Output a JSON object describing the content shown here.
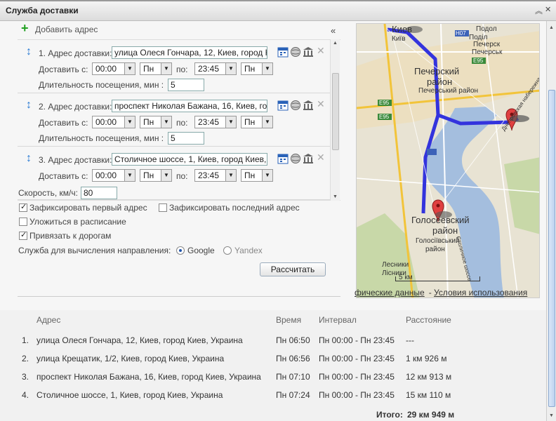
{
  "window": {
    "title": "Служба доставки",
    "restore_icon": "«",
    "minimize_icon": "»"
  },
  "panel": {
    "add_label": "Добавить адрес",
    "collapse_icon": "«"
  },
  "items": [
    {
      "num": "1.",
      "label": "Адрес доставки:",
      "address": "улица Олеся Гончара, 12, Киев, город К",
      "deliver_label": "Доставить с:",
      "from_time": "00:00",
      "from_day": "Пн",
      "to_label": "по:",
      "to_time": "23:45",
      "to_day": "Пн",
      "duration_label": "Длительность посещения, мин :",
      "duration": "5"
    },
    {
      "num": "2.",
      "label": "Адрес доставки:",
      "address": "проспект Николая Бажана, 16, Киев, го",
      "deliver_label": "Доставить с:",
      "from_time": "00:00",
      "from_day": "Пн",
      "to_label": "по:",
      "to_time": "23:45",
      "to_day": "Пн",
      "duration_label": "Длительность посещения, мин :",
      "duration": "5"
    },
    {
      "num": "3.",
      "label": "Адрес доставки:",
      "address": "Столичное шоссе, 1, Киев, город Киев,",
      "deliver_label": "Доставить с:",
      "from_time": "00:00",
      "from_day": "Пн",
      "to_label": "по:",
      "to_time": "23:45",
      "to_day": "Пн"
    }
  ],
  "options": {
    "speed_label": "Скорость, км/ч:",
    "speed": "80",
    "fix_first": {
      "label": "Зафиксировать первый адрес",
      "checked": true
    },
    "fix_last": {
      "label": "Зафиксировать последний адрес",
      "checked": false
    },
    "schedule": {
      "label": "Уложиться в расписание",
      "checked": false
    },
    "snap": {
      "label": "Привязать к дорогам",
      "checked": true
    },
    "service_label": "Служба для вычисления направления:",
    "google": "Google",
    "yandex": "Yandex",
    "calc_button": "Рассчитать"
  },
  "map": {
    "labels": [
      "Київ",
      "Киев",
      "Подол",
      "Поділ",
      "Печерск",
      "Печерськ",
      "Н07",
      "Е95",
      "Е95",
      "Е95",
      "Днепровская набережная",
      "Столичное шоссе",
      "Лесники",
      "Лісники",
      "Голосіївський",
      "район",
      "Печерський район"
    ],
    "big_labels": [
      "Печерский",
      "район",
      "Голосеевский",
      "район"
    ],
    "scale": "5 км",
    "footer_data": "фические данные",
    "footer_terms": "Условия использования",
    "accent_route": "#3333dd"
  },
  "results": {
    "headers": {
      "address": "Адрес",
      "time": "Время",
      "interval": "Интервал",
      "distance": "Расстояние"
    },
    "rows": [
      {
        "n": "1.",
        "address": "улица Олеся Гончара, 12, Киев, город Киев, Украина",
        "time": "Пн 06:50",
        "interval": "Пн 00:00 - Пн 23:45",
        "distance": "---"
      },
      {
        "n": "2.",
        "address": "улица Крещатик, 1/2, Киев, город Киев, Украина",
        "time": "Пн 06:56",
        "interval": "Пн 00:00 - Пн 23:45",
        "distance": "1 км 926 м"
      },
      {
        "n": "3.",
        "address": "проспект Николая Бажана, 16, Киев, город Киев, Украина",
        "time": "Пн 07:10",
        "interval": "Пн 00:00 - Пн 23:45",
        "distance": "12 км 913 м"
      },
      {
        "n": "4.",
        "address": "Столичное шоссе, 1, Киев, город Киев, Украина",
        "time": "Пн 07:24",
        "interval": "Пн 00:00 - Пн 23:45",
        "distance": "15 км 110 м"
      }
    ],
    "total_label": "Итого:",
    "total_value": "29 км 949 м"
  }
}
